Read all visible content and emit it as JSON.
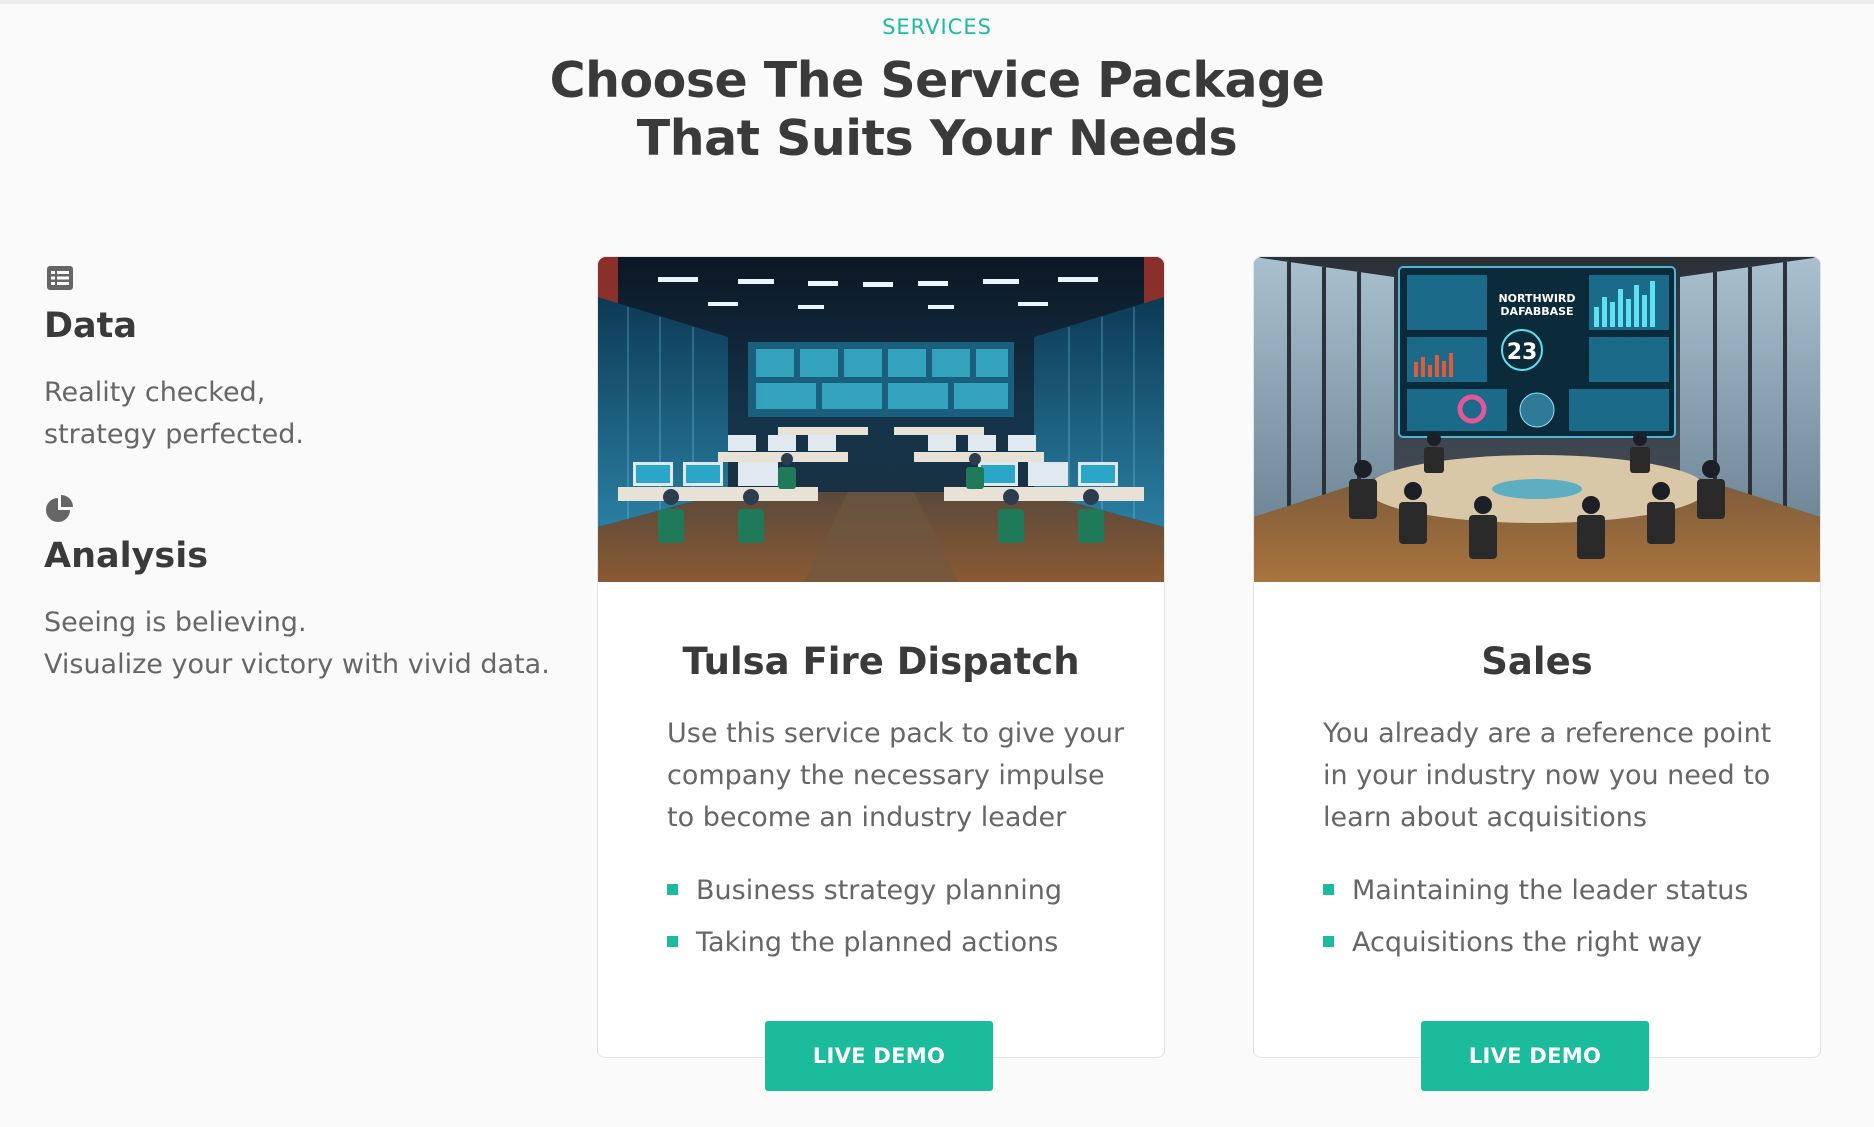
{
  "header": {
    "eyebrow": "SERVICES",
    "title_line1": "Choose The Service Package",
    "title_line2": "That Suits Your Needs"
  },
  "features": [
    {
      "icon": "list-icon",
      "title": "Data",
      "lines": [
        "Reality checked,",
        "strategy perfected."
      ]
    },
    {
      "icon": "pie-chart-icon",
      "title": "Analysis",
      "lines": [
        "Seeing is believing.",
        "Visualize your victory with vivid data."
      ]
    }
  ],
  "cards": [
    {
      "image": "dispatch-center-image",
      "title": "Tulsa Fire Dispatch",
      "description": [
        "Use this service pack to give your",
        "company the necessary impulse",
        "to become an industry leader"
      ],
      "bullets": [
        "Business strategy planning",
        "Taking the planned actions"
      ],
      "button": "LIVE DEMO"
    },
    {
      "image": "sales-boardroom-image",
      "title": "Sales",
      "description": [
        "You already are a reference point",
        "in your industry now you need to",
        "learn about acquisitions"
      ],
      "bullets": [
        "Maintaining the leader status",
        "Acquisitions the right way"
      ],
      "button": "LIVE DEMO",
      "image_text": {
        "screen_title_1": "NORTHWIRD",
        "screen_title_2": "DAFABBASE",
        "screen_number": "23"
      }
    }
  ],
  "colors": {
    "accent": "#1abc9c",
    "heading": "#3a3a3a",
    "body_text": "#666666",
    "background": "#fafafa"
  }
}
